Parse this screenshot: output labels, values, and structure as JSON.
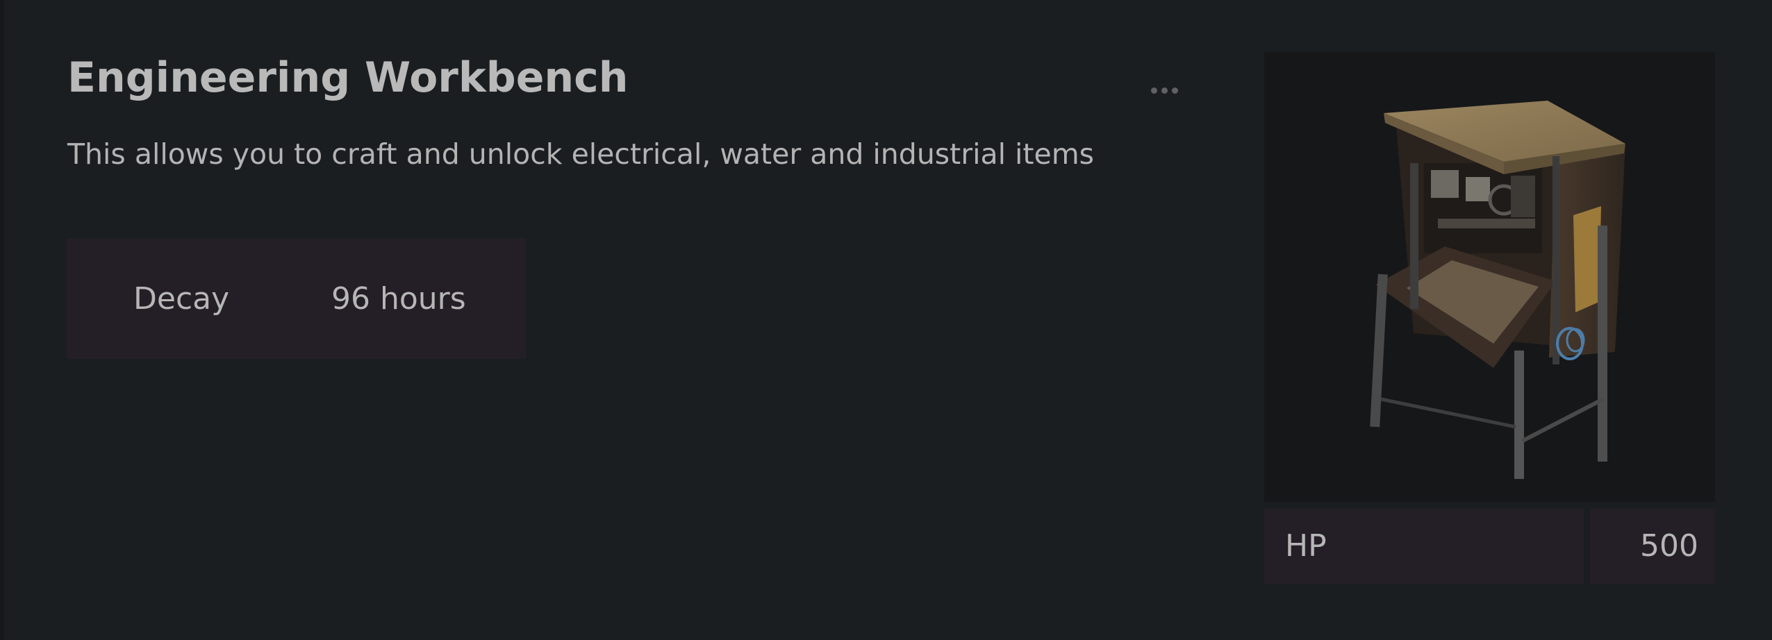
{
  "item": {
    "title": "Engineering Workbench",
    "description": "This allows you to craft and unlock electrical, water and industrial items",
    "image_alt": "workbench-image"
  },
  "stats": {
    "decay_label": "Decay",
    "decay_value": "96 hours",
    "hp_label": "HP",
    "hp_value": "500"
  },
  "menu": {
    "more_icon": "more-options-icon"
  },
  "colors": {
    "background": "#1b1e21",
    "stat_box": "#241f27",
    "image_bg": "#161719",
    "text": "#b6b6b6"
  }
}
